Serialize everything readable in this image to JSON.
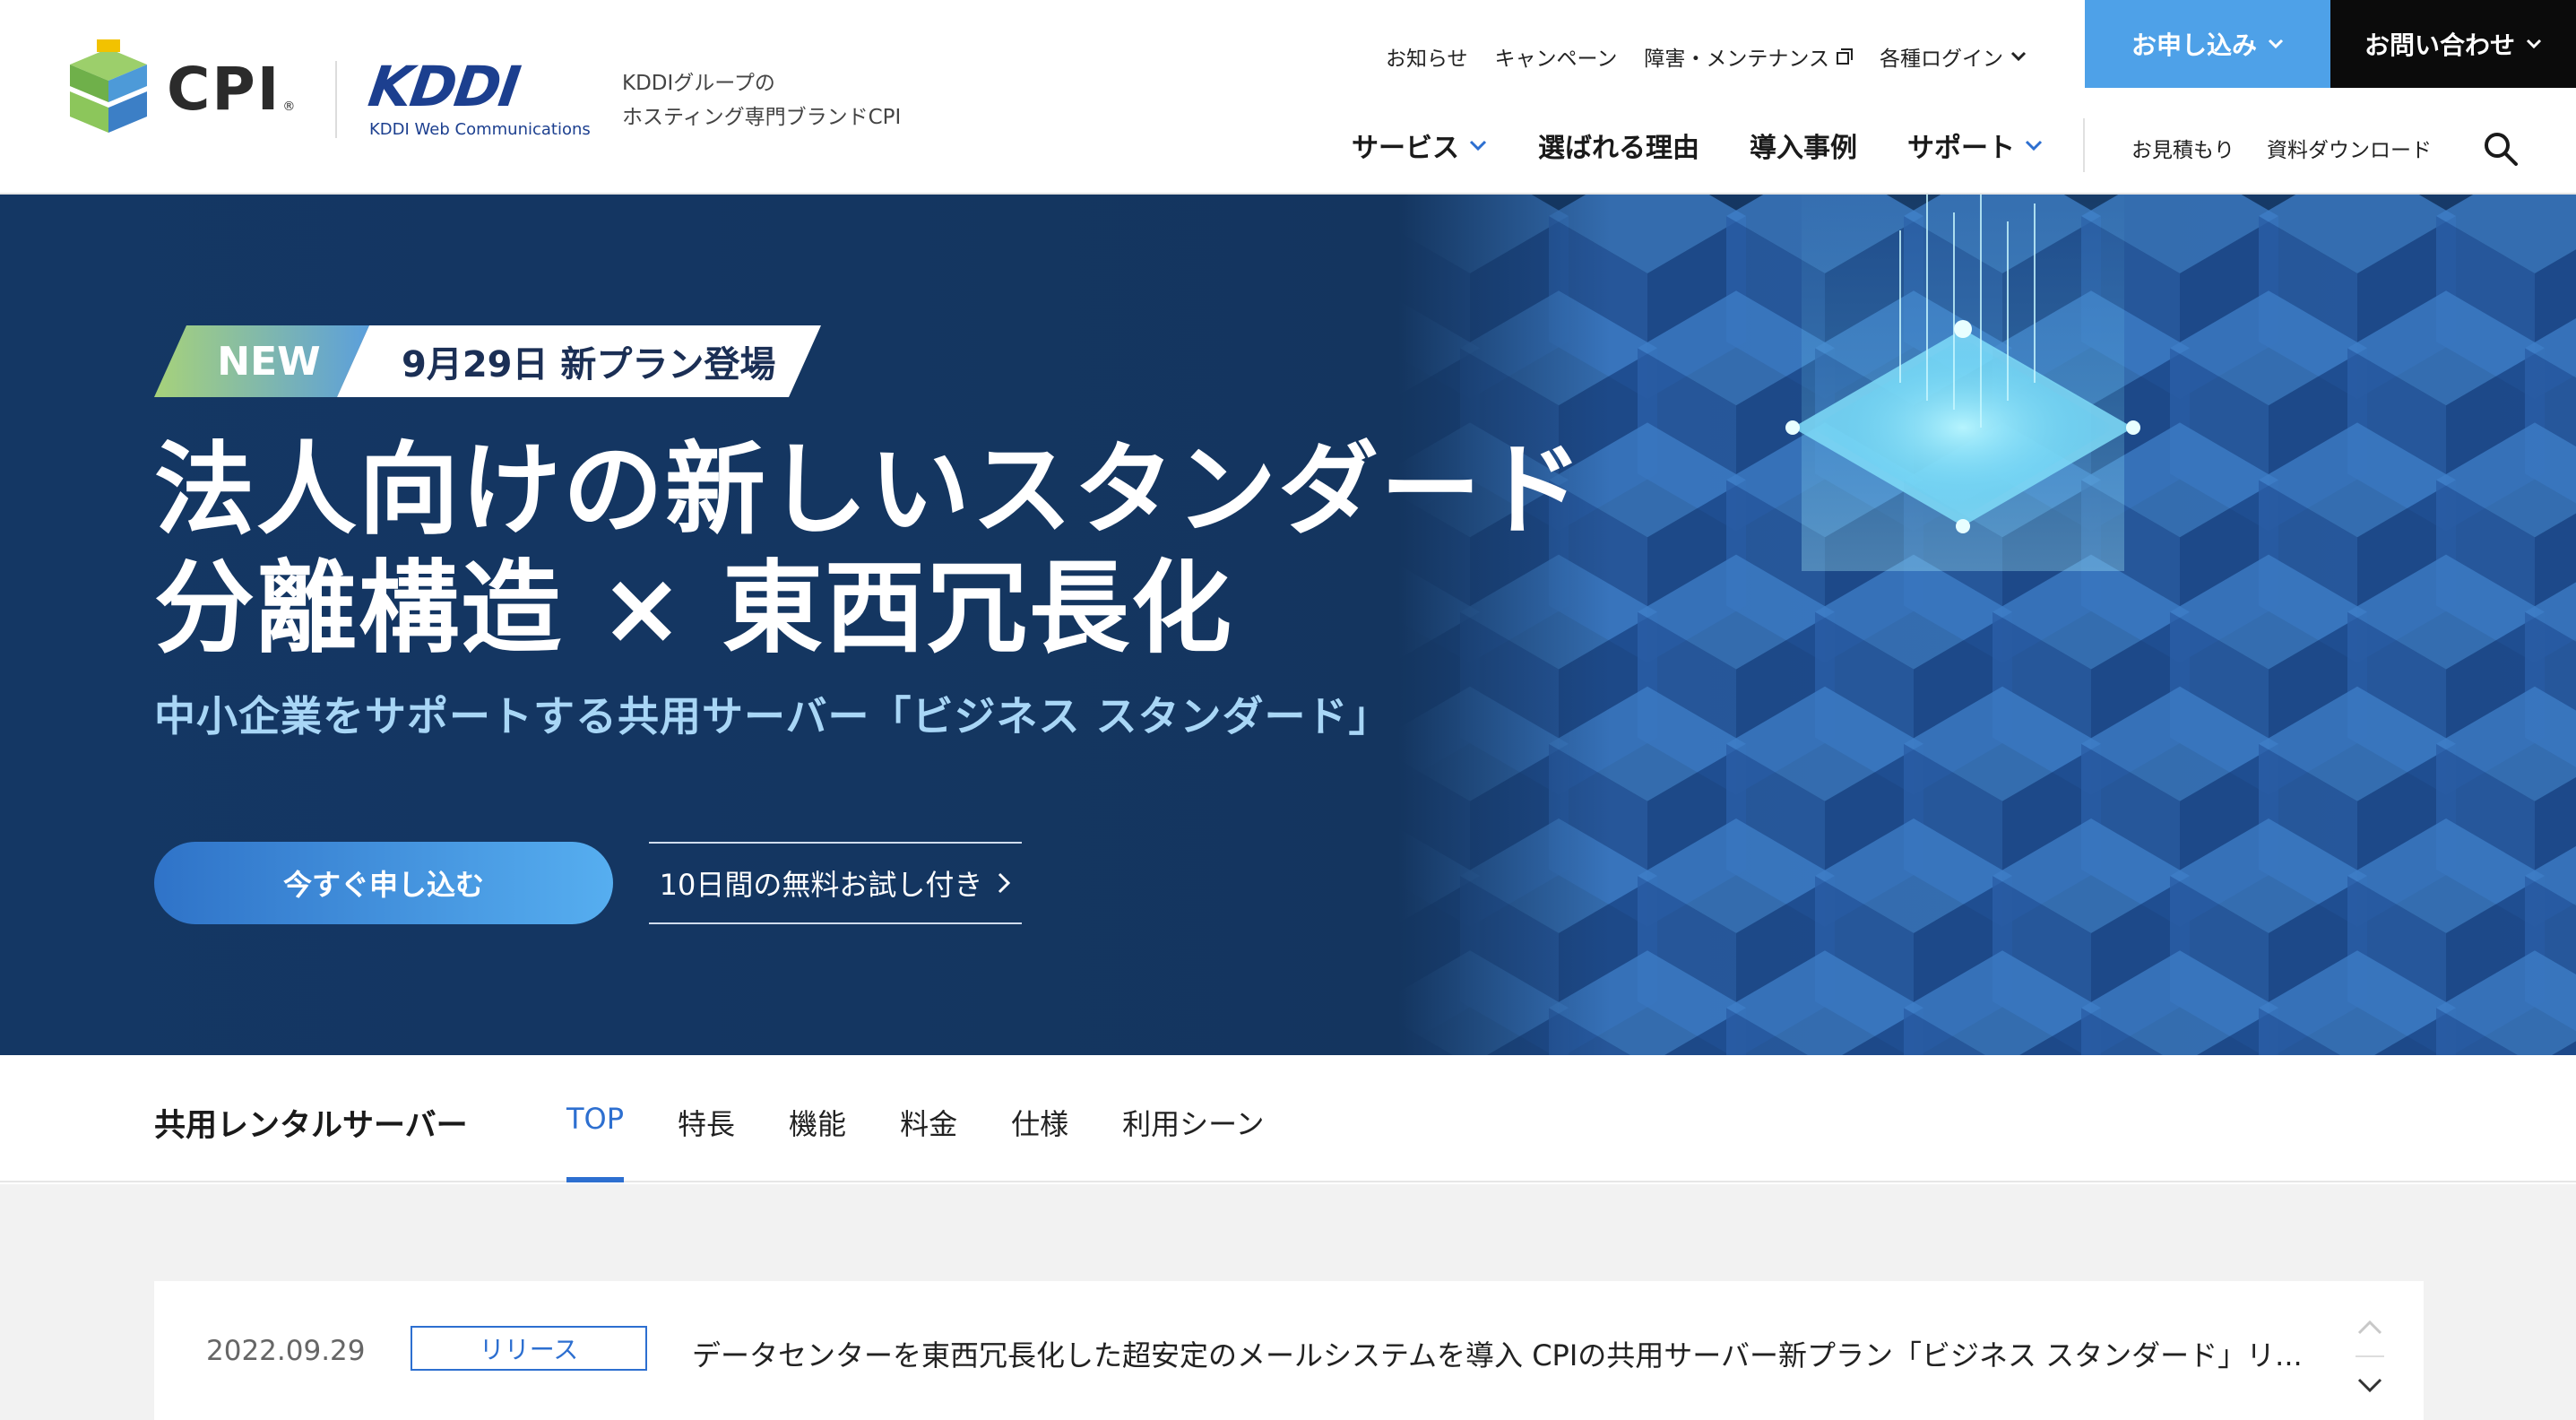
{
  "brand": {
    "cpi_logo_text": "CPI",
    "kddi_logo_text": "KDDI",
    "kddi_sub": "KDDI Web Communications",
    "tagline_line1": "KDDIグループの",
    "tagline_line2": "ホスティング専門ブランドCPI"
  },
  "util_nav": {
    "news": "お知らせ",
    "campaign": "キャンペーン",
    "maintenance": "障害・メンテナンス",
    "login": "各種ログイン"
  },
  "header_buttons": {
    "apply": "お申し込み",
    "contact": "お問い合わせ"
  },
  "main_nav": {
    "service": "サービス",
    "reasons": "選ばれる理由",
    "cases": "導入事例",
    "support": "サポート"
  },
  "sub_nav": {
    "estimate": "お見積もり",
    "download": "資料ダウンロード"
  },
  "hero": {
    "badge_new": "NEW",
    "badge_date": "9月29日 新プラン登場",
    "headline_line1": "法人向けの新しいスタンダード",
    "headline_line2": "分離構造 × 東西冗長化",
    "subheadline": "中小企業をサポートする共用サーバー「ビジネス スタンダード」",
    "cta_apply": "今すぐ申し込む",
    "cta_trial": "10日間の無料お試し付き"
  },
  "section_tabs": {
    "title": "共用レンタルサーバー",
    "items": [
      "TOP",
      "特長",
      "機能",
      "料金",
      "仕様",
      "利用シーン"
    ],
    "active": "TOP"
  },
  "news": {
    "date": "2022.09.29",
    "tag": "リリース",
    "text": "データセンターを東西冗長化した超安定のメールシステムを導入 CPIの共用サーバー新プラン「ビジネス スタンダード」リ..."
  },
  "colors": {
    "hero_bg": "#143764",
    "accent_blue": "#4ea1e8",
    "active_tab": "#2d6fd0",
    "contact_bg": "#0b0b0b",
    "subheadline": "#a8d6f6"
  }
}
